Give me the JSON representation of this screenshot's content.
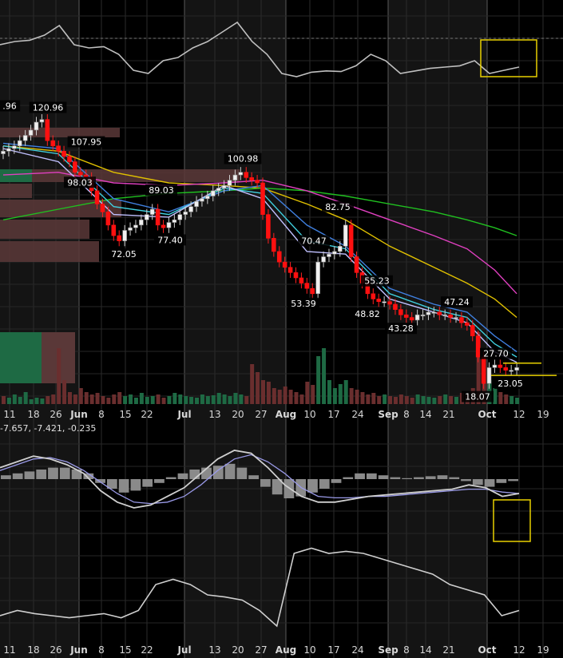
{
  "chart_data": {
    "type": "line",
    "x_axis": {
      "ticks": [
        {
          "label": "11",
          "bold": false
        },
        {
          "label": "18",
          "bold": false
        },
        {
          "label": "26",
          "bold": false
        },
        {
          "label": "Jun",
          "bold": true
        },
        {
          "label": "8",
          "bold": false
        },
        {
          "label": "15",
          "bold": false
        },
        {
          "label": "22",
          "bold": false
        },
        {
          "label": "Jul",
          "bold": true
        },
        {
          "label": "13",
          "bold": false
        },
        {
          "label": "20",
          "bold": false
        },
        {
          "label": "27",
          "bold": false
        },
        {
          "label": "Aug",
          "bold": true
        },
        {
          "label": "10",
          "bold": false
        },
        {
          "label": "17",
          "bold": false
        },
        {
          "label": "24",
          "bold": false
        },
        {
          "label": "Sep",
          "bold": true
        },
        {
          "label": "8",
          "bold": false
        },
        {
          "label": "14",
          "bold": false
        },
        {
          "label": "21",
          "bold": false
        },
        {
          "label": "Oct",
          "bold": true
        },
        {
          "label": "12",
          "bold": false
        },
        {
          "label": "19",
          "bold": false
        }
      ]
    },
    "price_panel": {
      "ylim": [
        14,
        132
      ],
      "price_labels": [
        {
          "text": ".96",
          "value": 120.96
        },
        {
          "text": "120.96",
          "value": 120.96
        },
        {
          "text": "107.95",
          "value": 107.95
        },
        {
          "text": "98.03",
          "value": 98.03
        },
        {
          "text": "89.03",
          "value": 89.03
        },
        {
          "text": "72.05",
          "value": 72.05
        },
        {
          "text": "77.40",
          "value": 77.4
        },
        {
          "text": "100.98",
          "value": 100.98
        },
        {
          "text": "82.75",
          "value": 82.75
        },
        {
          "text": "70.47",
          "value": 70.47
        },
        {
          "text": "53.39",
          "value": 53.39
        },
        {
          "text": "55.23",
          "value": 55.23
        },
        {
          "text": "48.82",
          "value": 48.82
        },
        {
          "text": "43.28",
          "value": 43.28
        },
        {
          "text": "47.24",
          "value": 47.24
        },
        {
          "text": "27.70",
          "value": 27.7
        },
        {
          "text": "23.05",
          "value": 23.05
        },
        {
          "text": "18.07",
          "value": 18.07
        }
      ],
      "close_series": [
        [
          0,
          108
        ],
        [
          1,
          109
        ],
        [
          2,
          110
        ],
        [
          3,
          112
        ],
        [
          4,
          114
        ],
        [
          5,
          116
        ],
        [
          6,
          119
        ],
        [
          7,
          120
        ],
        [
          8,
          112
        ],
        [
          9,
          110
        ],
        [
          10,
          108
        ],
        [
          11,
          106
        ],
        [
          12,
          104
        ],
        [
          13,
          100
        ],
        [
          14,
          99
        ],
        [
          15,
          98
        ],
        [
          16,
          93
        ],
        [
          17,
          88
        ],
        [
          18,
          85
        ],
        [
          19,
          80
        ],
        [
          20,
          76
        ],
        [
          21,
          74
        ],
        [
          22,
          78
        ],
        [
          23,
          79
        ],
        [
          24,
          80
        ],
        [
          25,
          82
        ],
        [
          26,
          84
        ],
        [
          27,
          86
        ],
        [
          28,
          80
        ],
        [
          29,
          79
        ],
        [
          30,
          81
        ],
        [
          31,
          82
        ],
        [
          32,
          84
        ],
        [
          33,
          85
        ],
        [
          34,
          87
        ],
        [
          35,
          89
        ],
        [
          36,
          90
        ],
        [
          37,
          91
        ],
        [
          38,
          93
        ],
        [
          39,
          94
        ],
        [
          40,
          95
        ],
        [
          41,
          97
        ],
        [
          42,
          99
        ],
        [
          43,
          100
        ],
        [
          44,
          98
        ],
        [
          45,
          97
        ],
        [
          46,
          96
        ],
        [
          47,
          84
        ],
        [
          48,
          75
        ],
        [
          49,
          70
        ],
        [
          50,
          66
        ],
        [
          51,
          64
        ],
        [
          52,
          62
        ],
        [
          53,
          60
        ],
        [
          54,
          58
        ],
        [
          55,
          56
        ],
        [
          56,
          54
        ],
        [
          57,
          66
        ],
        [
          58,
          68
        ],
        [
          59,
          69
        ],
        [
          60,
          70
        ],
        [
          61,
          72
        ],
        [
          62,
          80
        ],
        [
          63,
          68
        ],
        [
          64,
          62
        ],
        [
          65,
          58
        ],
        [
          66,
          54
        ],
        [
          67,
          52
        ],
        [
          68,
          51
        ],
        [
          69,
          51
        ],
        [
          70,
          50
        ],
        [
          71,
          48
        ],
        [
          72,
          46
        ],
        [
          73,
          45
        ],
        [
          74,
          44
        ],
        [
          75,
          46
        ],
        [
          76,
          46
        ],
        [
          77,
          47
        ],
        [
          78,
          47
        ],
        [
          79,
          46
        ],
        [
          80,
          46
        ],
        [
          81,
          45
        ],
        [
          82,
          45
        ],
        [
          83,
          43
        ],
        [
          84,
          42
        ],
        [
          85,
          38
        ],
        [
          86,
          30
        ],
        [
          87,
          20
        ],
        [
          88,
          26
        ],
        [
          89,
          27
        ],
        [
          90,
          26
        ],
        [
          91,
          25
        ],
        [
          92,
          25
        ],
        [
          93,
          26
        ]
      ],
      "moving_averages": [
        {
          "color": "#e0c000",
          "points": [
            [
              0,
              110
            ],
            [
              10,
              108
            ],
            [
              20,
              100
            ],
            [
              30,
              96
            ],
            [
              40,
              95
            ],
            [
              47,
              94
            ],
            [
              55,
              88
            ],
            [
              62,
              82
            ],
            [
              70,
              72
            ],
            [
              78,
              64
            ],
            [
              84,
              58
            ],
            [
              89,
              52
            ],
            [
              93,
              45
            ]
          ]
        },
        {
          "color": "#20c020",
          "points": [
            [
              0,
              82
            ],
            [
              10,
              86
            ],
            [
              20,
              90
            ],
            [
              30,
              92
            ],
            [
              40,
              93
            ],
            [
              47,
              94
            ],
            [
              55,
              93
            ],
            [
              62,
              91
            ],
            [
              70,
              88
            ],
            [
              78,
              85
            ],
            [
              84,
              82
            ],
            [
              89,
              79
            ],
            [
              93,
              76
            ]
          ]
        },
        {
          "color": "#e040c0",
          "points": [
            [
              0,
              99
            ],
            [
              10,
              100
            ],
            [
              20,
              96
            ],
            [
              30,
              95
            ],
            [
              40,
              96
            ],
            [
              47,
              97
            ],
            [
              55,
              93
            ],
            [
              62,
              88
            ],
            [
              70,
              82
            ],
            [
              78,
              76
            ],
            [
              84,
              71
            ],
            [
              89,
              63
            ],
            [
              93,
              54
            ]
          ]
        },
        {
          "color": "#4080e0",
          "points": [
            [
              0,
              111
            ],
            [
              10,
              109
            ],
            [
              20,
              90
            ],
            [
              30,
              85
            ],
            [
              40,
              93
            ],
            [
              47,
              95
            ],
            [
              55,
              80
            ],
            [
              62,
              72
            ],
            [
              70,
              56
            ],
            [
              78,
              50
            ],
            [
              84,
              47
            ],
            [
              89,
              38
            ],
            [
              93,
              32
            ]
          ]
        },
        {
          "color": "#40d0e0",
          "points": [
            [
              0,
              110
            ],
            [
              10,
              107
            ],
            [
              20,
              87
            ],
            [
              30,
              84
            ],
            [
              40,
              94
            ],
            [
              47,
              92
            ],
            [
              55,
              74
            ],
            [
              62,
              71
            ],
            [
              70,
              54
            ],
            [
              78,
              48
            ],
            [
              84,
              45
            ],
            [
              89,
              35
            ],
            [
              93,
              30
            ]
          ]
        },
        {
          "color": "#c0c0ff",
          "points": [
            [
              0,
              109
            ],
            [
              10,
              104
            ],
            [
              20,
              84
            ],
            [
              30,
              83
            ],
            [
              40,
              95
            ],
            [
              47,
              90
            ],
            [
              55,
              70
            ],
            [
              62,
              69
            ],
            [
              70,
              52
            ],
            [
              78,
              47
            ],
            [
              84,
              43
            ],
            [
              89,
              32
            ],
            [
              93,
              28
            ]
          ]
        }
      ]
    },
    "top_indicator": {
      "series": [
        0.55,
        0.6,
        0.62,
        0.7,
        0.85,
        0.55,
        0.5,
        0.52,
        0.4,
        0.15,
        0.1,
        0.3,
        0.35,
        0.5,
        0.6,
        0.75,
        0.9,
        0.6,
        0.4,
        0.1,
        0.05,
        0.12,
        0.14,
        0.13,
        0.22,
        0.4,
        0.3,
        0.1,
        0.14,
        0.18,
        0.2,
        0.22,
        0.3,
        0.1,
        0.15,
        0.2
      ]
    },
    "macd_panel": {
      "header": "-7.657, -7.421, -0.235"
    },
    "bottom_indicator": {
      "series": [
        0.3,
        0.35,
        0.32,
        0.3,
        0.28,
        0.3,
        0.32,
        0.28,
        0.35,
        0.6,
        0.65,
        0.6,
        0.5,
        0.48,
        0.45,
        0.35,
        0.2,
        0.9,
        0.95,
        0.9,
        0.92,
        0.9,
        0.85,
        0.8,
        0.75,
        0.7,
        0.6,
        0.55,
        0.5,
        0.3,
        0.35
      ]
    }
  }
}
